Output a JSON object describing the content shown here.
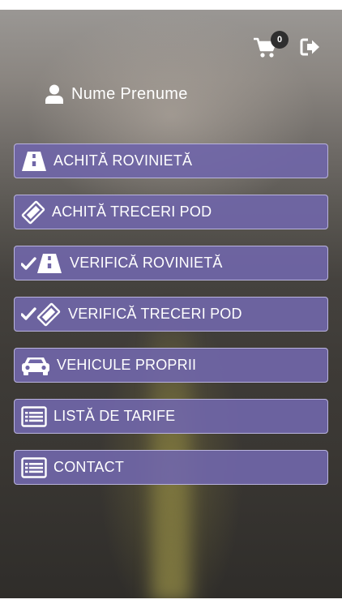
{
  "header": {
    "cart_count": "0",
    "cart_icon": "shopping-cart-icon",
    "logout_icon": "sign-out-icon"
  },
  "user": {
    "name": "Nume Prenume",
    "icon": "user-icon"
  },
  "menu": {
    "items": [
      {
        "label": "ACHITĂ ROVINIETĂ",
        "icon": "road-icon"
      },
      {
        "label": "ACHITĂ TRECERI POD",
        "icon": "ticket-icon"
      },
      {
        "label": "VERIFICĂ ROVINIETĂ",
        "icon": "check-road-icon"
      },
      {
        "label": "VERIFICĂ TRECERI POD",
        "icon": "check-ticket-icon"
      },
      {
        "label": "VEHICULE PROPRII",
        "icon": "car-icon"
      },
      {
        "label": "LISTĂ DE TARIFE",
        "icon": "list-icon"
      },
      {
        "label": "CONTACT",
        "icon": "list-icon"
      }
    ]
  },
  "colors": {
    "menu_bg": "#7066a8",
    "menu_border": "#b9b3dd",
    "text": "#ffffff",
    "badge_bg": "#2f2f2f"
  }
}
